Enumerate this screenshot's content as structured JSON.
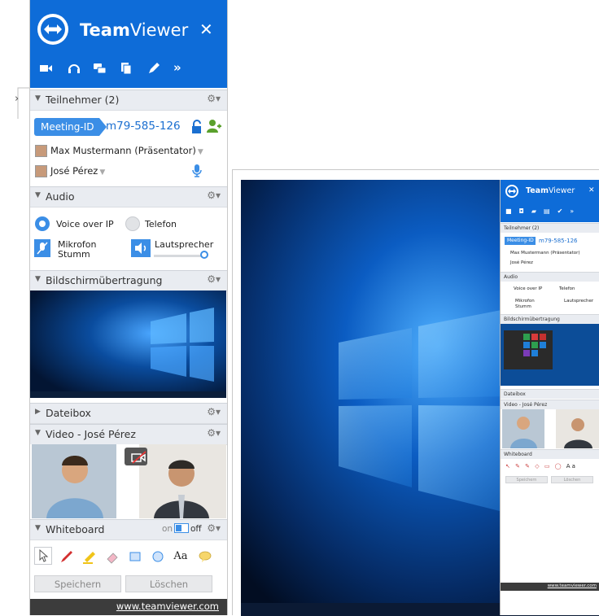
{
  "app": {
    "brand_bold": "Team",
    "brand_regular": "Viewer",
    "close_glyph": "✕"
  },
  "toolbar": {
    "icons": [
      "video-icon",
      "headset-icon",
      "chat-icon",
      "files-icon",
      "pen-icon",
      "more-icon"
    ]
  },
  "participants": {
    "title": "Teilnehmer (2)",
    "meeting_id_label": "Meeting-ID",
    "meeting_id_value": "m79-585-126",
    "users": [
      {
        "name": "Max Mustermann (Präsentator)"
      },
      {
        "name": "José Pérez"
      }
    ]
  },
  "audio": {
    "title": "Audio",
    "voip_label": "Voice over IP",
    "phone_label": "Telefon",
    "mic_label_line1": "Mikrofon",
    "mic_label_line2": "Stumm",
    "speaker_label": "Lautsprecher",
    "speaker_level": 0.95
  },
  "screen_share": {
    "title": "Bildschirmübertragung"
  },
  "filebox": {
    "title": "Dateibox"
  },
  "video": {
    "title": "Video - José Pérez"
  },
  "whiteboard": {
    "title": "Whiteboard",
    "toggle_on": "on",
    "toggle_off": "off",
    "save_label": "Speichern",
    "clear_label": "Löschen",
    "text_tool": "Aa"
  },
  "footer": {
    "link": "www.teamviewer.com"
  },
  "colors": {
    "header_blue": "#0e6cd8",
    "accent_blue": "#3b8ee6",
    "green": "#5aa02c"
  }
}
